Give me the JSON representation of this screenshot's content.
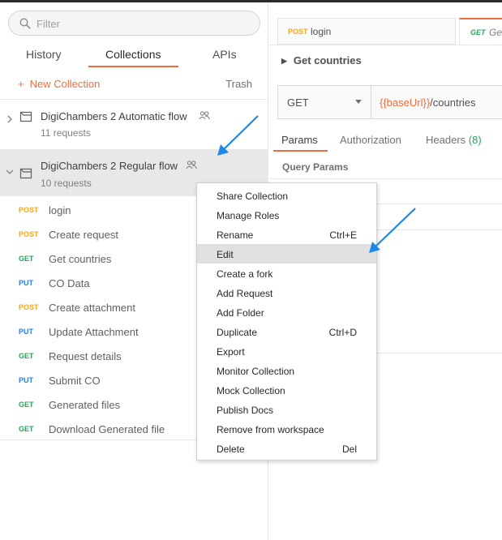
{
  "search": {
    "placeholder": "Filter"
  },
  "tabs": [
    {
      "label": "History"
    },
    {
      "label": "Collections"
    },
    {
      "label": "APIs"
    }
  ],
  "actions": {
    "new_collection": "New Collection",
    "trash": "Trash"
  },
  "collections": [
    {
      "name": "DigiChambers 2 Automatic flow",
      "count": "11 requests"
    },
    {
      "name": "DigiChambers 2 Regular flow",
      "count": "10 requests"
    }
  ],
  "requests": [
    {
      "method": "POST",
      "name": "login"
    },
    {
      "method": "POST",
      "name": "Create request"
    },
    {
      "method": "GET",
      "name": "Get countries"
    },
    {
      "method": "PUT",
      "name": "CO Data"
    },
    {
      "method": "POST",
      "name": "Create attachment"
    },
    {
      "method": "PUT",
      "name": "Update Attachment"
    },
    {
      "method": "GET",
      "name": "Request details"
    },
    {
      "method": "PUT",
      "name": "Submit CO"
    },
    {
      "method": "GET",
      "name": "Generated files"
    },
    {
      "method": "GET",
      "name": "Download Generated file"
    }
  ],
  "right": {
    "tab1": {
      "method": "POST",
      "label": "login"
    },
    "tab2": {
      "method": "GET",
      "label": "Get"
    },
    "request_title": "Get countries",
    "method_select": "GET",
    "url_var": "{{baseUrl}}",
    "url_path": "/countries",
    "subtabs": {
      "params": "Params",
      "authorization": "Authorization",
      "headers": "Headers",
      "headers_count": "(8)"
    },
    "query_params": "Query Params"
  },
  "context_menu": [
    {
      "label": "Share Collection",
      "shortcut": ""
    },
    {
      "label": "Manage Roles",
      "shortcut": ""
    },
    {
      "label": "Rename",
      "shortcut": "Ctrl+E"
    },
    {
      "label": "Edit",
      "shortcut": ""
    },
    {
      "label": "Create a fork",
      "shortcut": ""
    },
    {
      "label": "Add Request",
      "shortcut": ""
    },
    {
      "label": "Add Folder",
      "shortcut": ""
    },
    {
      "label": "Duplicate",
      "shortcut": "Ctrl+D"
    },
    {
      "label": "Export",
      "shortcut": ""
    },
    {
      "label": "Monitor Collection",
      "shortcut": ""
    },
    {
      "label": "Mock Collection",
      "shortcut": ""
    },
    {
      "label": "Publish Docs",
      "shortcut": ""
    },
    {
      "label": "Remove from workspace",
      "shortcut": ""
    },
    {
      "label": "Delete",
      "shortcut": "Del"
    }
  ],
  "colors": {
    "accent": "#f26b3a",
    "post": "#f5a623",
    "get": "#26a55b",
    "put": "#2d7fe0",
    "annotation_arrow": "#1e88e5"
  }
}
